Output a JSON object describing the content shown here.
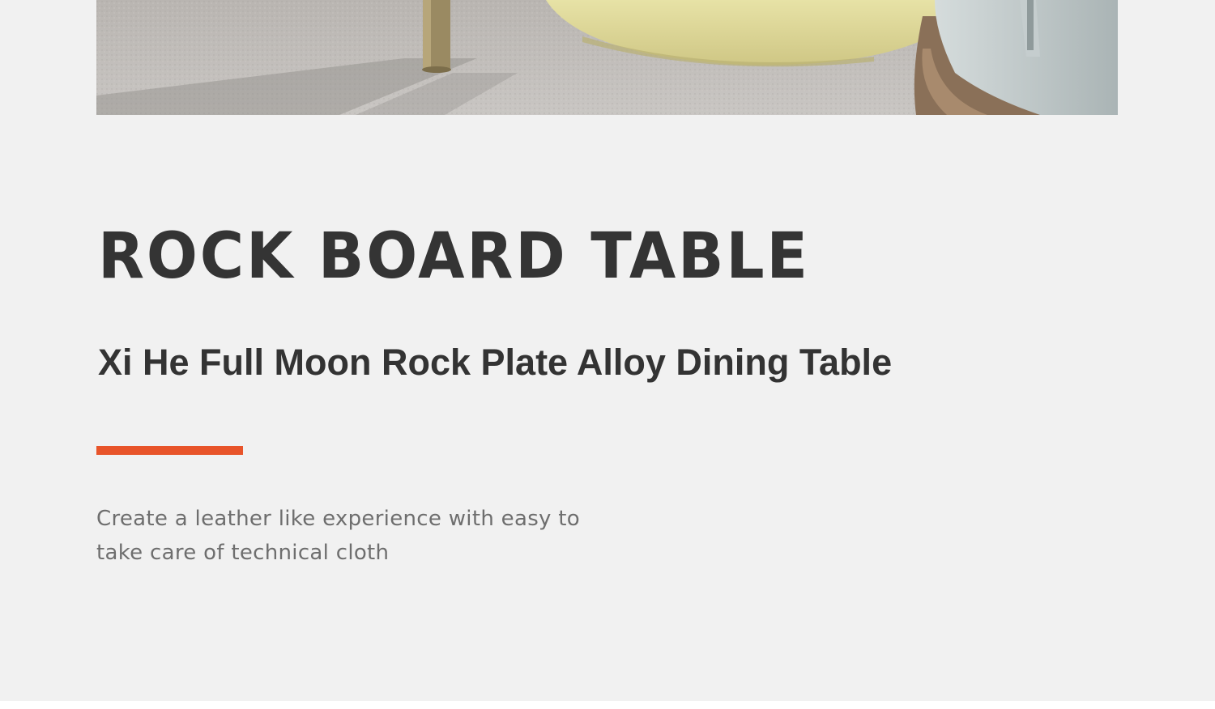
{
  "hero_image": {
    "subject": "dining-table-with-chair-photo"
  },
  "headline": "ROCK BOARD TABLE",
  "subtitle": "Xi He Full Moon Rock Plate Alloy Dining Table",
  "description": {
    "line1": "Create a leather like experience with easy to",
    "line2": "take care of technical cloth"
  },
  "colors": {
    "background": "#f1f1f1",
    "accent": "#e8542a",
    "headline": "#343434",
    "body": "#6e6e6e"
  }
}
